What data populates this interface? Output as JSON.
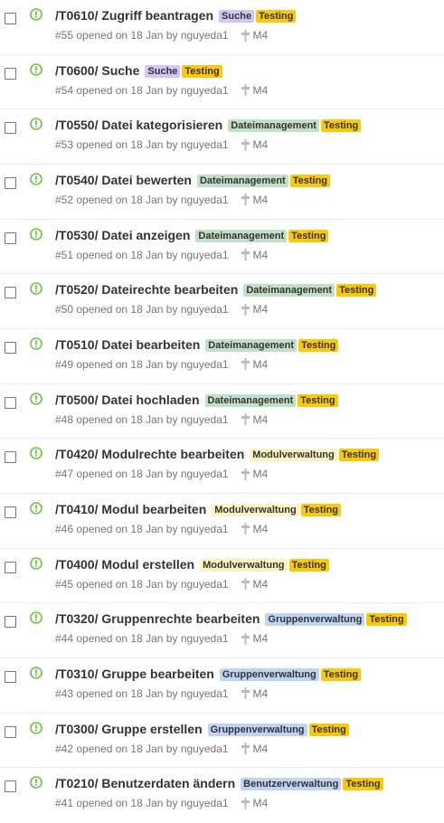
{
  "colors": {
    "open_icon": "#6cc644",
    "label_suche": "#d4c5f9",
    "label_testing": "#fbca04",
    "label_dateimanagement": "#c2e0c6",
    "label_modulverwaltung": "#fef2c0",
    "label_gruppenverwaltung": "#bfd4f2",
    "label_benutzerverwaltung": "#bfd4f2"
  },
  "issues": [
    {
      "title": "/T0610/ Zugriff beantragen",
      "labels": [
        {
          "text": "Suche",
          "color": "#d4c5f9"
        },
        {
          "text": "Testing",
          "color": "#fbca04"
        }
      ],
      "number": "#55",
      "opened": "opened on 18 Jan by",
      "author": "nguyeda1",
      "milestone": "M4"
    },
    {
      "title": "/T0600/ Suche",
      "labels": [
        {
          "text": "Suche",
          "color": "#d4c5f9"
        },
        {
          "text": "Testing",
          "color": "#fbca04"
        }
      ],
      "number": "#54",
      "opened": "opened on 18 Jan by",
      "author": "nguyeda1",
      "milestone": "M4"
    },
    {
      "title": "/T0550/ Datei kategorisieren",
      "labels": [
        {
          "text": "Dateimanagement",
          "color": "#c2e0c6"
        },
        {
          "text": "Testing",
          "color": "#fbca04"
        }
      ],
      "number": "#53",
      "opened": "opened on 18 Jan by",
      "author": "nguyeda1",
      "milestone": "M4"
    },
    {
      "title": "/T0540/ Datei bewerten",
      "labels": [
        {
          "text": "Dateimanagement",
          "color": "#c2e0c6"
        },
        {
          "text": "Testing",
          "color": "#fbca04"
        }
      ],
      "number": "#52",
      "opened": "opened on 18 Jan by",
      "author": "nguyeda1",
      "milestone": "M4"
    },
    {
      "title": "/T0530/ Datei anzeigen",
      "labels": [
        {
          "text": "Dateimanagement",
          "color": "#c2e0c6"
        },
        {
          "text": "Testing",
          "color": "#fbca04"
        }
      ],
      "number": "#51",
      "opened": "opened on 18 Jan by",
      "author": "nguyeda1",
      "milestone": "M4"
    },
    {
      "title": "/T0520/ Dateirechte bearbeiten",
      "labels": [
        {
          "text": "Dateimanagement",
          "color": "#c2e0c6"
        },
        {
          "text": "Testing",
          "color": "#fbca04"
        }
      ],
      "number": "#50",
      "opened": "opened on 18 Jan by",
      "author": "nguyeda1",
      "milestone": "M4"
    },
    {
      "title": "/T0510/ Datei bearbeiten",
      "labels": [
        {
          "text": "Dateimanagement",
          "color": "#c2e0c6"
        },
        {
          "text": "Testing",
          "color": "#fbca04"
        }
      ],
      "number": "#49",
      "opened": "opened on 18 Jan by",
      "author": "nguyeda1",
      "milestone": "M4"
    },
    {
      "title": "/T0500/ Datei hochladen",
      "labels": [
        {
          "text": "Dateimanagement",
          "color": "#c2e0c6"
        },
        {
          "text": "Testing",
          "color": "#fbca04"
        }
      ],
      "number": "#48",
      "opened": "opened on 18 Jan by",
      "author": "nguyeda1",
      "milestone": "M4"
    },
    {
      "title": "/T0420/ Modulrechte bearbeiten",
      "labels": [
        {
          "text": "Modulverwaltung",
          "color": "#fef2c0"
        },
        {
          "text": "Testing",
          "color": "#fbca04"
        }
      ],
      "number": "#47",
      "opened": "opened on 18 Jan by",
      "author": "nguyeda1",
      "milestone": "M4"
    },
    {
      "title": "/T0410/ Modul bearbeiten",
      "labels": [
        {
          "text": "Modulverwaltung",
          "color": "#fef2c0"
        },
        {
          "text": "Testing",
          "color": "#fbca04"
        }
      ],
      "number": "#46",
      "opened": "opened on 18 Jan by",
      "author": "nguyeda1",
      "milestone": "M4"
    },
    {
      "title": "/T0400/ Modul erstellen",
      "labels": [
        {
          "text": "Modulverwaltung",
          "color": "#fef2c0"
        },
        {
          "text": "Testing",
          "color": "#fbca04"
        }
      ],
      "number": "#45",
      "opened": "opened on 18 Jan by",
      "author": "nguyeda1",
      "milestone": "M4"
    },
    {
      "title": "/T0320/ Gruppenrechte bearbeiten",
      "labels": [
        {
          "text": "Gruppenverwaltung",
          "color": "#bfd4f2"
        },
        {
          "text": "Testing",
          "color": "#fbca04"
        }
      ],
      "number": "#44",
      "opened": "opened on 18 Jan by",
      "author": "nguyeda1",
      "milestone": "M4"
    },
    {
      "title": "/T0310/ Gruppe bearbeiten",
      "labels": [
        {
          "text": "Gruppenverwaltung",
          "color": "#bfd4f2"
        },
        {
          "text": "Testing",
          "color": "#fbca04"
        }
      ],
      "number": "#43",
      "opened": "opened on 18 Jan by",
      "author": "nguyeda1",
      "milestone": "M4"
    },
    {
      "title": "/T0300/ Gruppe erstellen",
      "labels": [
        {
          "text": "Gruppenverwaltung",
          "color": "#bfd4f2"
        },
        {
          "text": "Testing",
          "color": "#fbca04"
        }
      ],
      "number": "#42",
      "opened": "opened on 18 Jan by",
      "author": "nguyeda1",
      "milestone": "M4"
    },
    {
      "title": "/T0210/ Benutzerdaten ändern",
      "labels": [
        {
          "text": "Benutzerverwaltung",
          "color": "#bfd4f2"
        },
        {
          "text": "Testing",
          "color": "#fbca04"
        }
      ],
      "number": "#41",
      "opened": "opened on 18 Jan by",
      "author": "nguyeda1",
      "milestone": "M4"
    }
  ]
}
